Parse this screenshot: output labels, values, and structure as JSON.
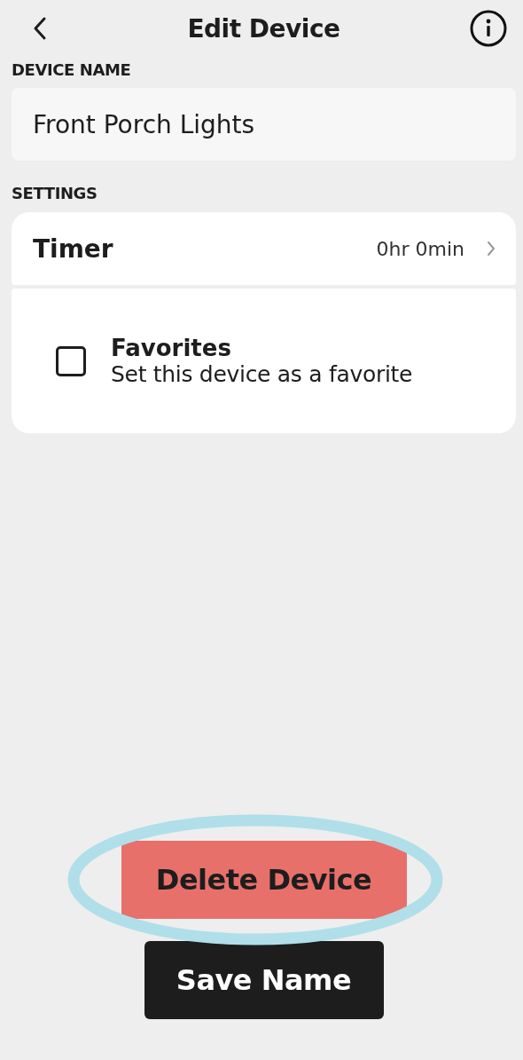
{
  "header": {
    "title": "Edit Device"
  },
  "device_name": {
    "label": "DEVICE NAME",
    "value": "Front Porch Lights"
  },
  "settings": {
    "label": "SETTINGS",
    "timer": {
      "label": "Timer",
      "value": "0hr 0min"
    },
    "favorites": {
      "title": "Favorites",
      "description": "Set this device as a favorite",
      "checked": false
    }
  },
  "buttons": {
    "delete": {
      "label": "Delete Device",
      "highlighted": true
    },
    "save": {
      "label": "Save Name"
    }
  }
}
